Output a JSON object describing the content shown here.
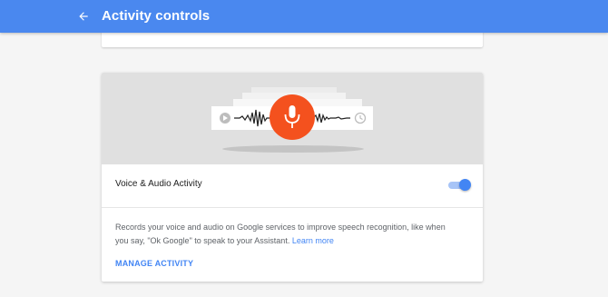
{
  "appbar": {
    "title": "Activity controls",
    "back_icon": "arrow-back-icon",
    "color": "#4a88ef"
  },
  "card": {
    "hero_icons": {
      "mic": "microphone-icon",
      "play": "play-icon",
      "clock": "clock-icon"
    },
    "mic_color": "#f4511e",
    "setting_title": "Voice & Audio Activity",
    "toggle_on": true,
    "toggle_color": "#4285f4",
    "description": "Records your voice and audio on Google services to improve speech recognition, like when you say, \"Ok Google\" to speak to your Assistant.",
    "learn_more": "Learn more",
    "manage_label": "MANAGE ACTIVITY"
  }
}
